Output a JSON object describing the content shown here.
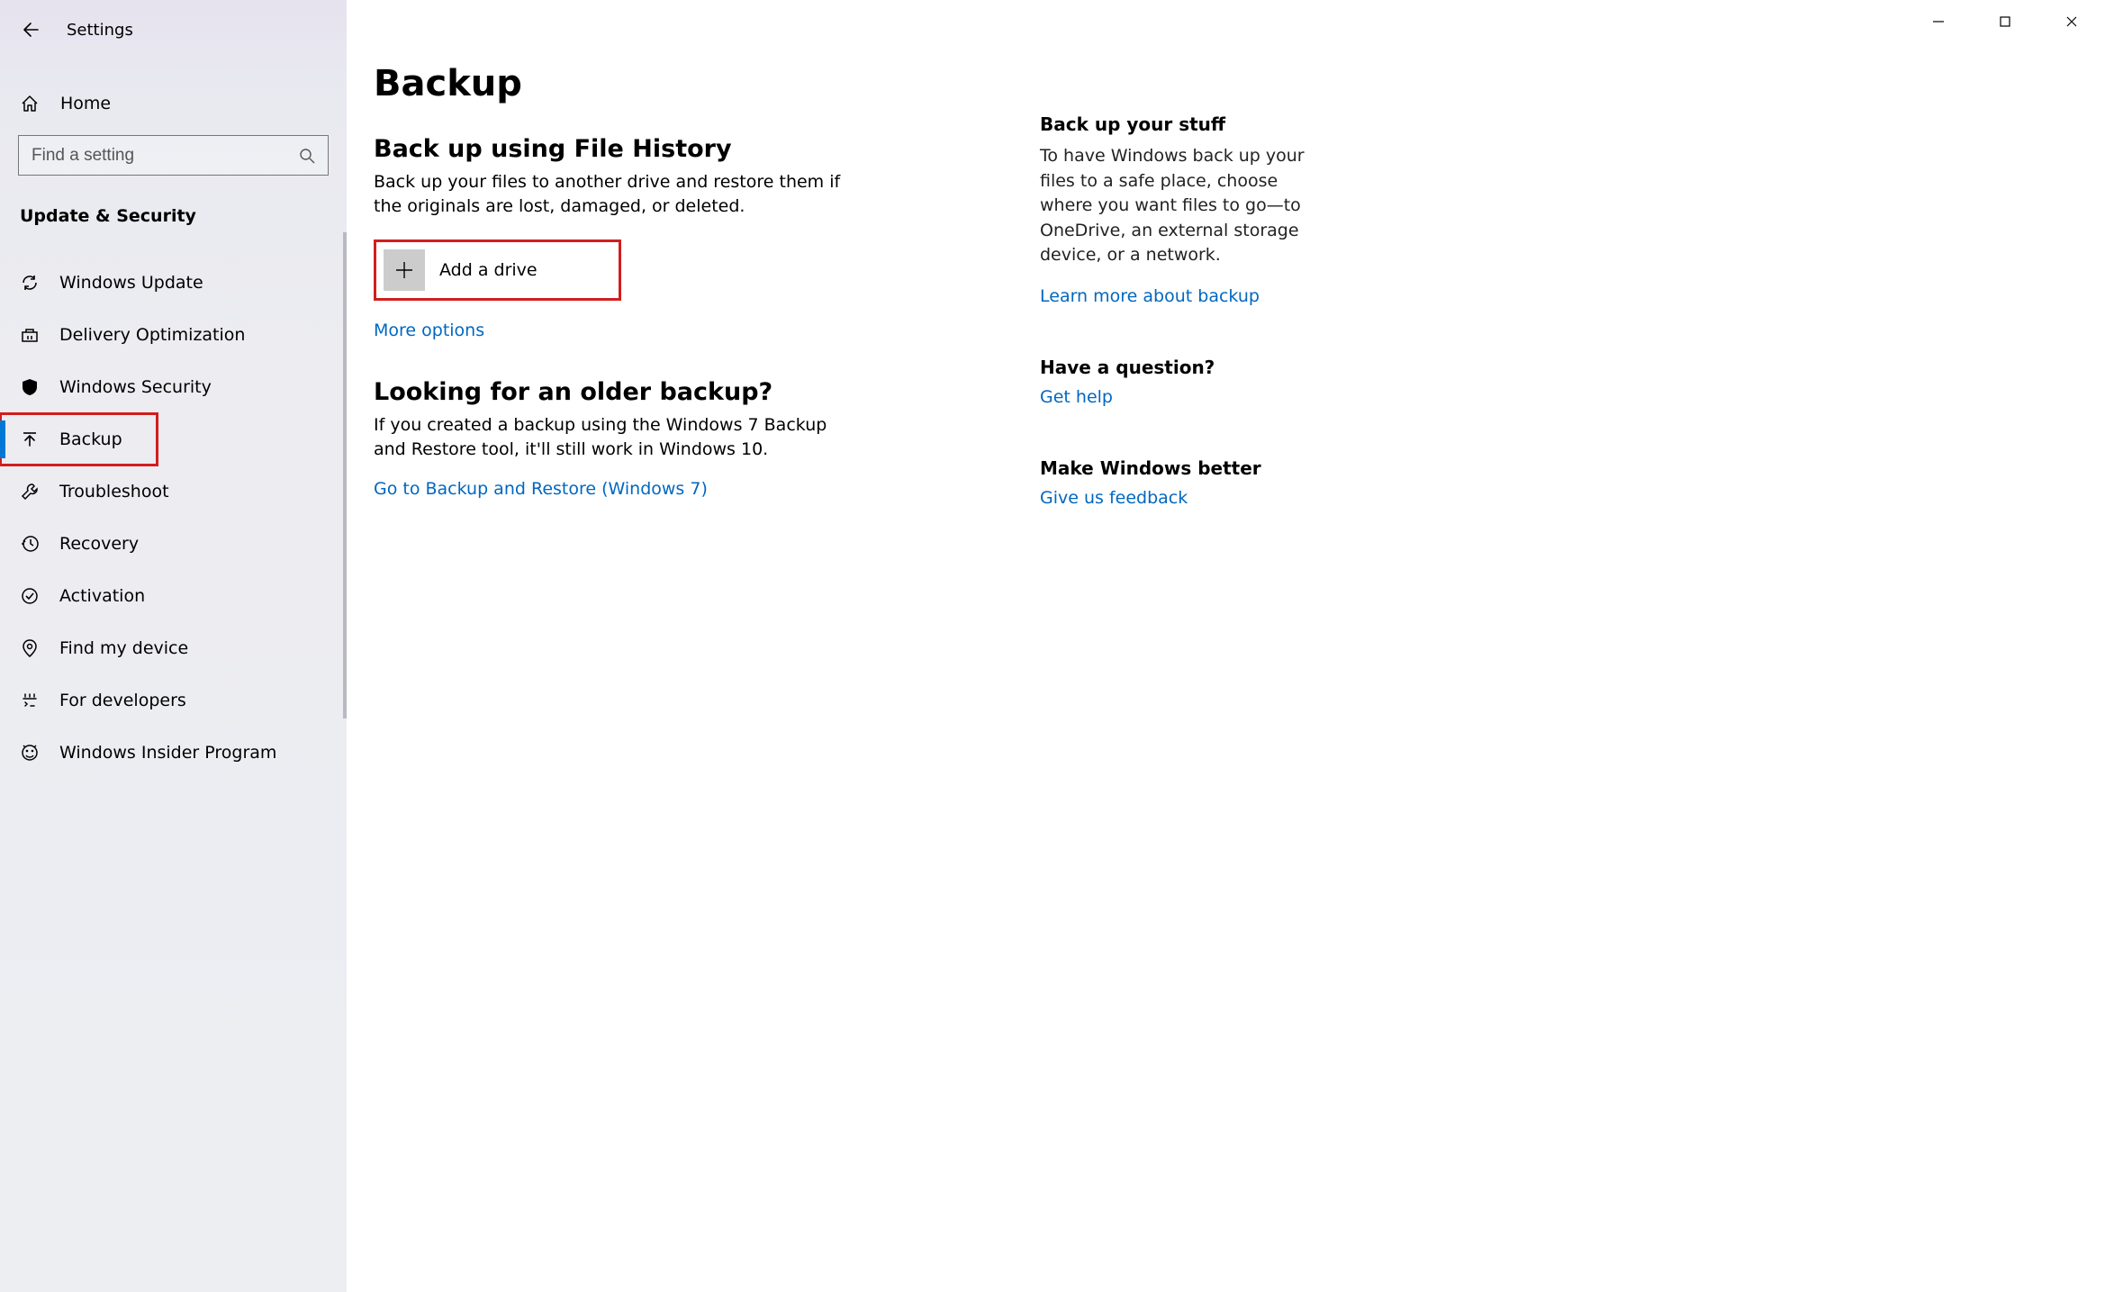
{
  "window": {
    "title": "Settings"
  },
  "sidebar": {
    "home_label": "Home",
    "search_placeholder": "Find a setting",
    "category": "Update & Security",
    "items": [
      {
        "label": "Windows Update"
      },
      {
        "label": "Delivery Optimization"
      },
      {
        "label": "Windows Security"
      },
      {
        "label": "Backup"
      },
      {
        "label": "Troubleshoot"
      },
      {
        "label": "Recovery"
      },
      {
        "label": "Activation"
      },
      {
        "label": "Find my device"
      },
      {
        "label": "For developers"
      },
      {
        "label": "Windows Insider Program"
      }
    ]
  },
  "main": {
    "page_title": "Backup",
    "section1": {
      "title": "Back up using File History",
      "desc": "Back up your files to another drive and restore them if the originals are lost, damaged, or deleted.",
      "add_drive": "Add a drive",
      "more_options": "More options"
    },
    "section2": {
      "title": "Looking for an older backup?",
      "desc": "If you created a backup using the Windows 7 Backup and Restore tool, it'll still work in Windows 10.",
      "link": "Go to Backup and Restore (Windows 7)"
    }
  },
  "rail": {
    "block1": {
      "title": "Back up your stuff",
      "desc": "To have Windows back up your files to a safe place, choose where you want files to go—to OneDrive, an external storage device, or a network.",
      "link": "Learn more about backup"
    },
    "block2": {
      "title": "Have a question?",
      "link": "Get help"
    },
    "block3": {
      "title": "Make Windows better",
      "link": "Give us feedback"
    }
  }
}
